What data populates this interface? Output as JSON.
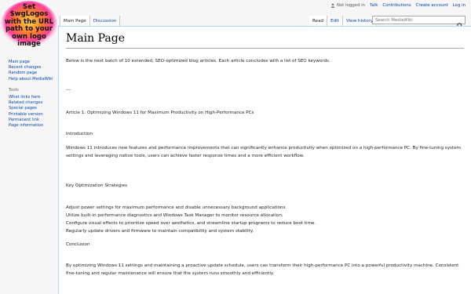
{
  "logo": {
    "text": "Set $wgLogos with the URL path to your own logo image"
  },
  "personal_tools": {
    "not_logged_in": "Not logged in",
    "talk": "Talk",
    "contributions": "Contributions",
    "create_account": "Create account",
    "log_in": "Log in"
  },
  "tabs": {
    "main_page": "Main Page",
    "discussion": "Discussion",
    "read": "Read",
    "edit": "Edit",
    "view_history": "View history"
  },
  "search": {
    "placeholder": "Search MediaWiki"
  },
  "sidebar": {
    "nav": [
      "Main page",
      "Recent changes",
      "Random page",
      "Help about MediaWiki"
    ],
    "tools_heading": "Tools",
    "tools": [
      "What links here",
      "Related changes",
      "Special pages",
      "Printable version",
      "Permanent link",
      "Page information"
    ]
  },
  "content": {
    "title": "Main Page",
    "intro": "Below is the next batch of 10 extended, SEO-optimized blog articles. Each article concludes with a list of SEO keywords.",
    "separator": "---",
    "article_title": "Article 1: Optimizing Windows 11 for Maximum Productivity on High-Performance PCs",
    "intro_heading": "Introduction",
    "intro_text": "Windows 11 introduces new features and performance improvements that can significantly enhance productivity when optimized on a high-performance PC. By fine-tuning system settings and leveraging native tools, users can achieve faster response times and a more efficient workflow.",
    "strategies_heading": "Key Optimization Strategies",
    "strategies": [
      "Adjust power settings for maximum performance and disable unnecessary background applications.",
      "Utilize built-in performance diagnostics and Windows Task Manager to monitor resource allocation.",
      "Configure visual effects to prioritize speed over aesthetics, and streamline startup programs to reduce boot time.",
      "Regularly update drivers and firmware to maintain compatibility and system stability."
    ],
    "conclusion_heading": "Conclusion",
    "conclusion_text": "By optimizing Windows 11 settings and maintaining a proactive update schedule, users can transform their high-performance PC into a powerful productivity machine. Consistent fine-tuning and regular maintenance will ensure that the system runs smoothly and efficiently."
  }
}
